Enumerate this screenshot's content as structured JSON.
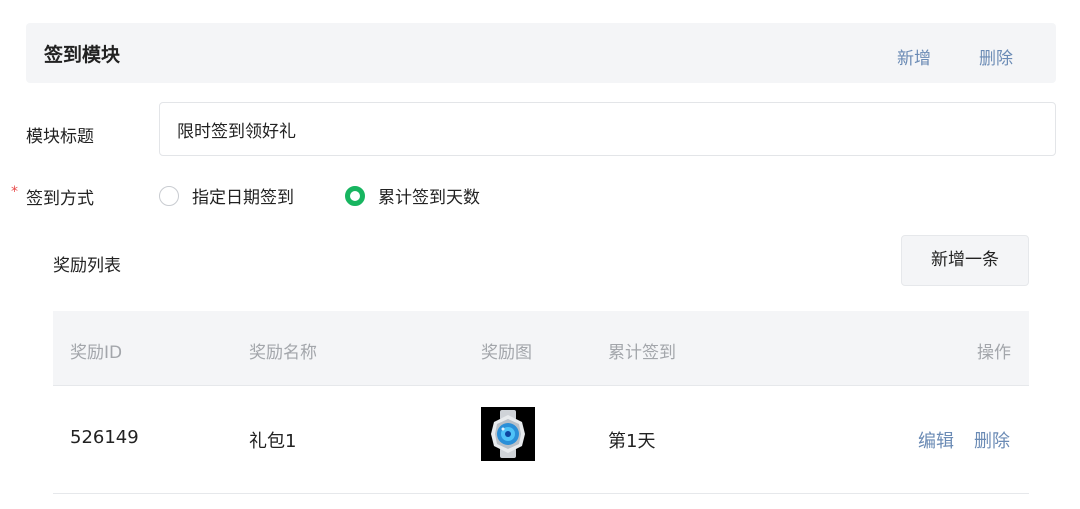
{
  "module": {
    "title": "签到模块",
    "add_label": "新增",
    "delete_label": "删除"
  },
  "form": {
    "title_label": "模块标题",
    "title_value": "限时签到领好礼",
    "method_label": "签到方式",
    "required_mark": "*",
    "method_options": [
      {
        "label": "指定日期签到",
        "selected": false
      },
      {
        "label": "累计签到天数",
        "selected": true
      }
    ]
  },
  "rewards": {
    "title": "奖励列表",
    "add_row_label": "新增一条",
    "columns": [
      "奖励ID",
      "奖励名称",
      "奖励图",
      "累计签到",
      "操作"
    ],
    "rows": [
      {
        "id": "526149",
        "name": "礼包1",
        "image_icon": "watch-thumbnail",
        "days": "第1天",
        "edit_label": "编辑",
        "delete_label": "删除"
      }
    ]
  },
  "colors": {
    "accent_link": "#6b8bb5",
    "radio_checked": "#17b560",
    "required": "#e84a4a"
  }
}
